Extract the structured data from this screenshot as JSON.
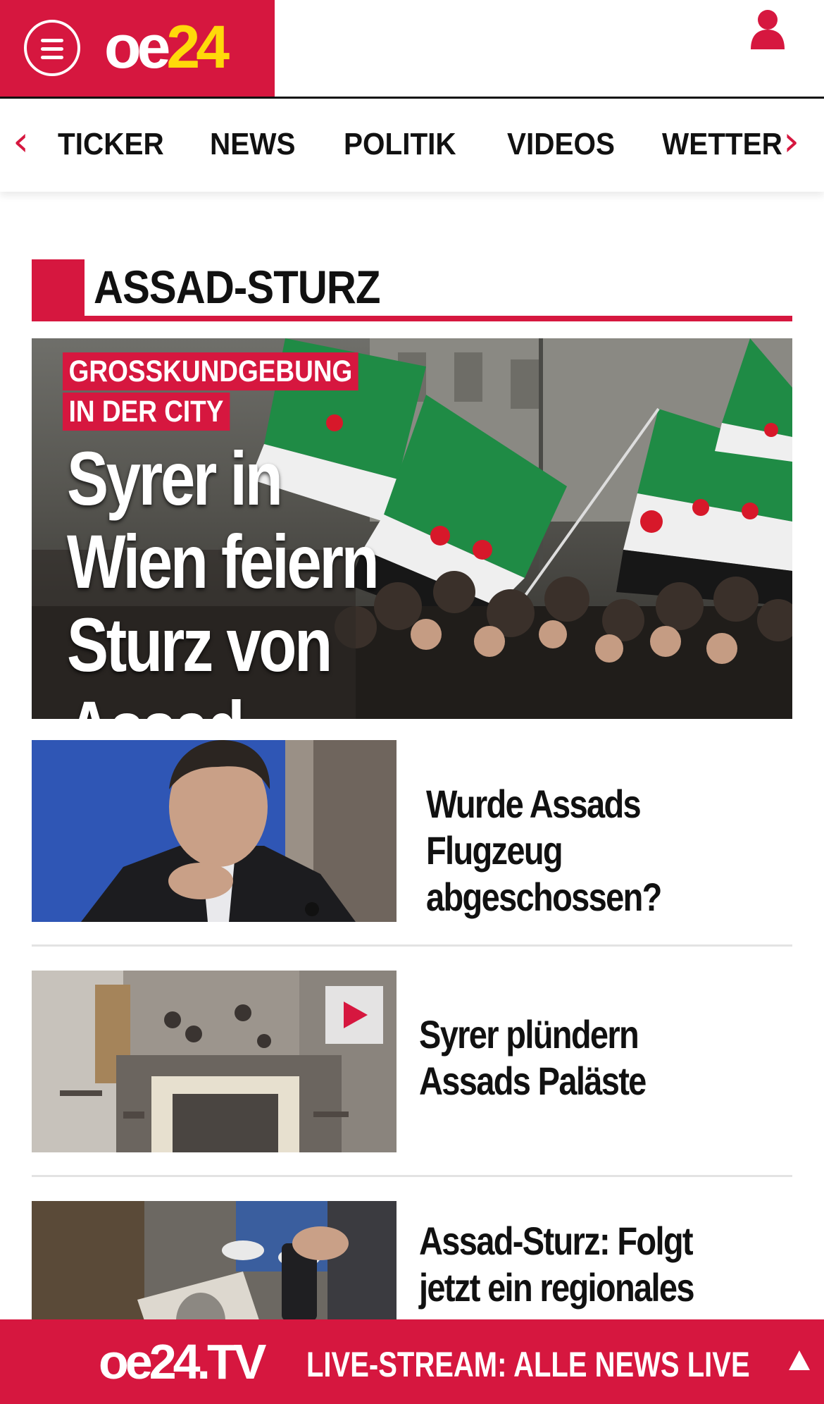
{
  "header": {
    "logo_oe": "oe",
    "logo_num": "24",
    "menu_icon": "hamburger-menu-icon",
    "user_icon": "user-icon"
  },
  "nav": {
    "prev_arrow": "‹",
    "next_arrow": "›",
    "items": [
      "TICKER",
      "NEWS",
      "POLITIK",
      "VIDEOS",
      "WETTER"
    ]
  },
  "section": {
    "title": "ASSAD-STURZ"
  },
  "hero": {
    "kicker_line1": "GROSSKUNDGEBUNG",
    "kicker_line2": "IN DER CITY",
    "title": "Syrer in Wien feiern Sturz von Assad"
  },
  "articles": [
    {
      "title": "Wurde Assads Flugzeug abgeschossen?",
      "has_video": false
    },
    {
      "title": "Syrer plündern Assads Paläste",
      "has_video": true
    },
    {
      "title": "Assad-Sturz: Folgt jetzt ein regionales",
      "has_video": false
    }
  ],
  "live_bar": {
    "logo": "oe24.TV",
    "text": "LIVE-STREAM:  ALLE NEWS LIVE",
    "arrow_icon": "scroll-up-icon"
  },
  "colors": {
    "brand_red": "#d6173f",
    "logo_yellow": "#ffd90a"
  }
}
